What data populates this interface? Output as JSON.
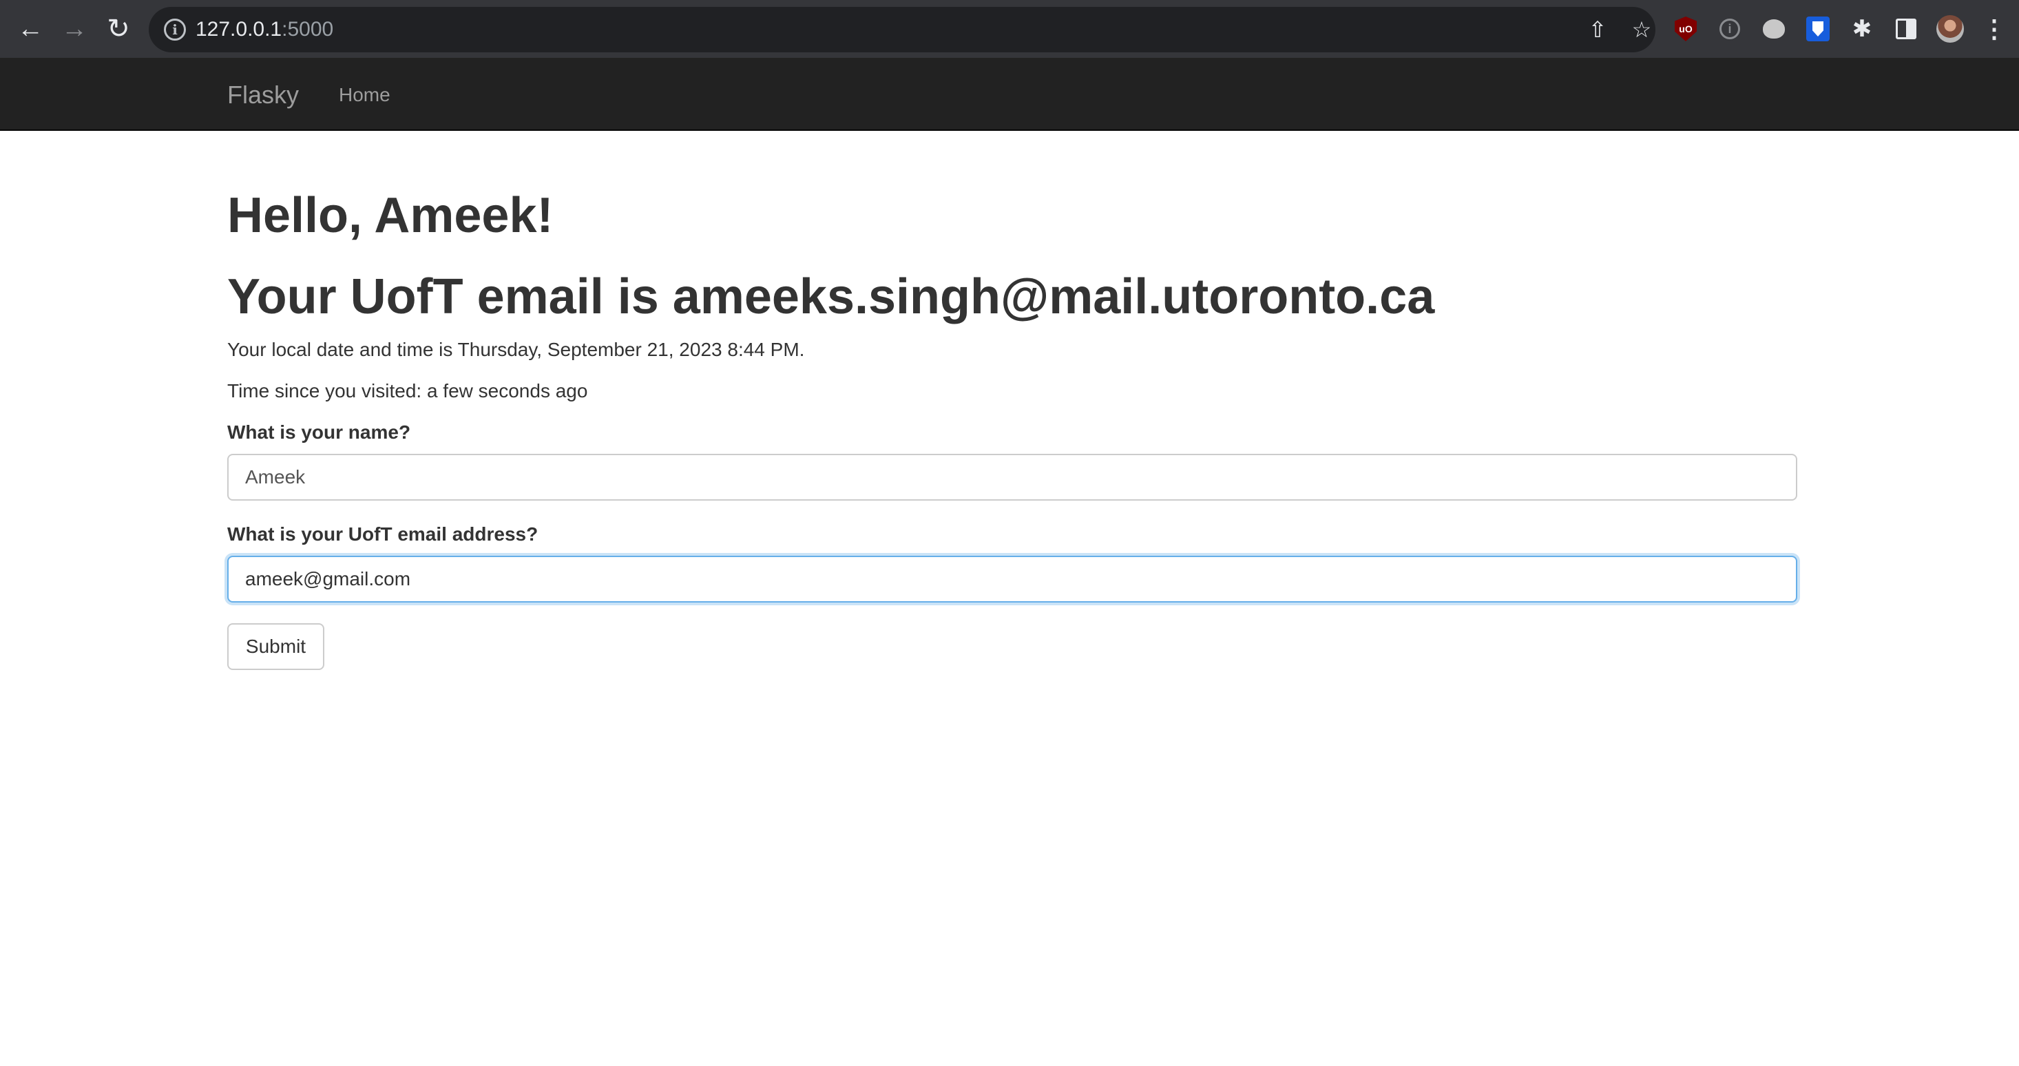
{
  "browser": {
    "url_host": "127.0.0.1",
    "url_port": ":5000",
    "icons": {
      "back": "arrow-left-icon",
      "forward": "arrow-right-icon",
      "reload": "reload-icon",
      "site_info": "info-icon",
      "share": "share-icon",
      "bookmark": "star-icon",
      "extensions": [
        "ublock-origin-icon",
        "info-extension-icon",
        "blob-extension-icon",
        "bitwarden-icon",
        "puzzle-icon",
        "side-panel-icon",
        "profile-avatar",
        "kebab-menu-icon"
      ]
    }
  },
  "navbar": {
    "brand": "Flasky",
    "links": [
      {
        "label": "Home"
      }
    ]
  },
  "page": {
    "greeting": "Hello, Ameek!",
    "email_heading": "Your UofT email is ameeks.singh@mail.utoronto.ca",
    "local_time": "Your local date and time is Thursday, September 21, 2023 8:44 PM.",
    "time_since": "Time since you visited: a few seconds ago"
  },
  "form": {
    "name_label": "What is your name?",
    "name_value": "Ameek",
    "email_label": "What is your UofT email address?",
    "email_value": "ameek@gmail.com",
    "submit_label": "Submit"
  },
  "colors": {
    "chrome_bg": "#35363a",
    "navbar_bg": "#222222",
    "navbar_text": "#9d9d9d",
    "text": "#333333",
    "focus_border": "#66afe9"
  }
}
